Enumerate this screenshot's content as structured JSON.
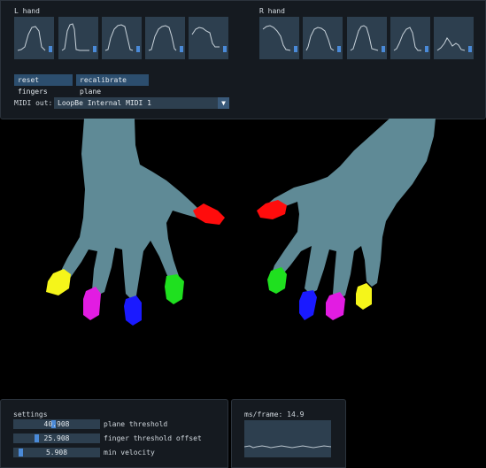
{
  "left_hand": {
    "label": "L hand",
    "finger_levels": [
      0.25,
      0.25,
      0.25,
      0.25,
      0.25
    ]
  },
  "right_hand": {
    "label": "R hand",
    "finger_levels": [
      0.25,
      0.25,
      0.25,
      0.25,
      0.25
    ]
  },
  "buttons": {
    "reset_fingers": "reset fingers",
    "recalibrate_plane": "recalibrate plane"
  },
  "midi": {
    "label": "MIDI out:",
    "selected": "LoopBe Internal MIDI 1"
  },
  "settings": {
    "title": "settings",
    "sliders": [
      {
        "label": "plane threshold",
        "value": "40.908",
        "fraction": 0.45
      },
      {
        "label": "finger threshold offset",
        "value": "25.908",
        "fraction": 0.26
      },
      {
        "label": "min velocity",
        "value": "5.908",
        "fraction": 0.06
      }
    ]
  },
  "perf": {
    "label": "ms/frame: 14.9"
  },
  "colors": {
    "skin": "#5f8a96",
    "red": "#ff0c0c",
    "yellow": "#f5f51a",
    "magenta": "#e21ce2",
    "blue": "#1a1aff",
    "green": "#1fe01f",
    "accent": "#4a8ad8"
  }
}
